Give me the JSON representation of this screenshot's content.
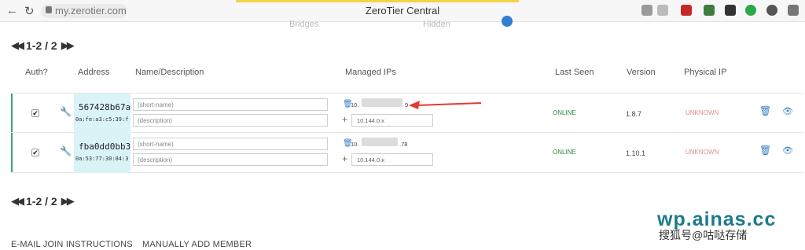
{
  "browser": {
    "back_glyph": "←",
    "reload_glyph": "↻",
    "url": "my.zerotier.com",
    "title": "ZeroTier Central"
  },
  "ghost_labels": [
    "Bridges",
    "Hidden"
  ],
  "pagination": {
    "top_label": "1-2 / 2",
    "bottom_label": "1-2 / 2",
    "prev_glyph": "◀◀",
    "next_glyph": "▶▶"
  },
  "table": {
    "headers": {
      "auth": "Auth?",
      "address": "Address",
      "name": "Name/Description",
      "managed_ips": "Managed IPs",
      "last_seen": "Last Seen",
      "version": "Version",
      "physical_ip": "Physical IP"
    },
    "rows": [
      {
        "authorized": "✔",
        "address": "567428b67a",
        "mac": "0a:fe:a3:c5:39:f",
        "name_placeholder": "(short-name)",
        "desc_placeholder": "(description)",
        "ip_prefix": "10.",
        "ip_suffix": "9",
        "ip_input_placeholder": "10.144.0.x",
        "last_seen": "ONLINE",
        "version": "1.8.7",
        "physical_ip": "UNKNOWN"
      },
      {
        "authorized": "✔",
        "address": "fba0dd0bb3",
        "mac": "0a:53:77:30:84:3",
        "name_placeholder": "(short-name)",
        "desc_placeholder": "(description)",
        "ip_prefix": "10.",
        "ip_suffix": ".78",
        "ip_input_placeholder": "10.144.0.x",
        "last_seen": "ONLINE",
        "version": "1.10.1",
        "physical_ip": "UNKNOWN"
      }
    ]
  },
  "footer": {
    "email_join": "E-MAIL JOIN INSTRUCTIONS",
    "manual_add": "MANUALLY ADD MEMBER"
  },
  "watermark": {
    "site": "wp.ainas.cc",
    "sub": "搜狐号@咕哒存储"
  },
  "icons": {
    "trash": "trash-icon",
    "eye": "eye-icon",
    "wrench": "wrench-icon",
    "plus": "plus-icon"
  },
  "colors": {
    "online": "#2b8a3e",
    "unknown": "#e08b8b",
    "accent": "#3a82c4",
    "address_bg": "#d9f3f7",
    "arrow": "#e53935",
    "row_accent": "#3aa76d"
  }
}
